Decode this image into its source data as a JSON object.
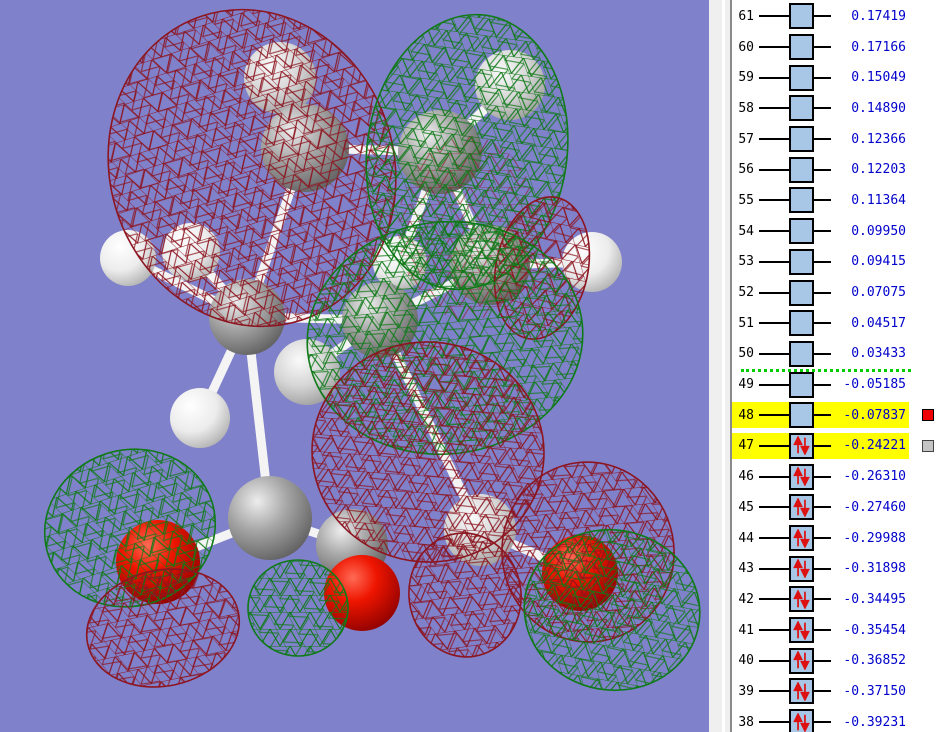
{
  "view": {
    "background_color": "#8081cb",
    "description": "3d-molecular-orbital-view"
  },
  "molecule": {
    "positive_mesh_color": "#8c1520",
    "negative_mesh_color": "#0f7a18",
    "oxygen_color": "#dd1100",
    "carbon_color": "#909090",
    "hydrogen_color": "#f2f2f2"
  },
  "diagram": {
    "box_fill": "#a8c6e6",
    "value_color": "#0000cc",
    "arrow_color": "#dd1111",
    "highlight_color": "#ffff00",
    "separator_color": "#00cc00",
    "marker_red": "#ee0000",
    "marker_gray": "#c4c4c4",
    "separator_between": [
      "50",
      "49"
    ],
    "rows": [
      {
        "n": "61",
        "value": "0.17419",
        "occupied": false,
        "highlighted": false,
        "marker": null
      },
      {
        "n": "60",
        "value": "0.17166",
        "occupied": false,
        "highlighted": false,
        "marker": null
      },
      {
        "n": "59",
        "value": "0.15049",
        "occupied": false,
        "highlighted": false,
        "marker": null
      },
      {
        "n": "58",
        "value": "0.14890",
        "occupied": false,
        "highlighted": false,
        "marker": null
      },
      {
        "n": "57",
        "value": "0.12366",
        "occupied": false,
        "highlighted": false,
        "marker": null
      },
      {
        "n": "56",
        "value": "0.12203",
        "occupied": false,
        "highlighted": false,
        "marker": null
      },
      {
        "n": "55",
        "value": "0.11364",
        "occupied": false,
        "highlighted": false,
        "marker": null
      },
      {
        "n": "54",
        "value": "0.09950",
        "occupied": false,
        "highlighted": false,
        "marker": null
      },
      {
        "n": "53",
        "value": "0.09415",
        "occupied": false,
        "highlighted": false,
        "marker": null
      },
      {
        "n": "52",
        "value": "0.07075",
        "occupied": false,
        "highlighted": false,
        "marker": null
      },
      {
        "n": "51",
        "value": "0.04517",
        "occupied": false,
        "highlighted": false,
        "marker": null
      },
      {
        "n": "50",
        "value": "0.03433",
        "occupied": false,
        "highlighted": false,
        "marker": null
      },
      {
        "n": "49",
        "value": "-0.05185",
        "occupied": false,
        "highlighted": false,
        "marker": null
      },
      {
        "n": "48",
        "value": "-0.07837",
        "occupied": false,
        "highlighted": true,
        "marker": "red"
      },
      {
        "n": "47",
        "value": "-0.24221",
        "occupied": true,
        "highlighted": true,
        "marker": "gray"
      },
      {
        "n": "46",
        "value": "-0.26310",
        "occupied": true,
        "highlighted": false,
        "marker": null
      },
      {
        "n": "45",
        "value": "-0.27460",
        "occupied": true,
        "highlighted": false,
        "marker": null
      },
      {
        "n": "44",
        "value": "-0.29988",
        "occupied": true,
        "highlighted": false,
        "marker": null
      },
      {
        "n": "43",
        "value": "-0.31898",
        "occupied": true,
        "highlighted": false,
        "marker": null
      },
      {
        "n": "42",
        "value": "-0.34495",
        "occupied": true,
        "highlighted": false,
        "marker": null
      },
      {
        "n": "41",
        "value": "-0.35454",
        "occupied": true,
        "highlighted": false,
        "marker": null
      },
      {
        "n": "40",
        "value": "-0.36852",
        "occupied": true,
        "highlighted": false,
        "marker": null
      },
      {
        "n": "39",
        "value": "-0.37150",
        "occupied": true,
        "highlighted": false,
        "marker": null
      },
      {
        "n": "38",
        "value": "-0.39231",
        "occupied": true,
        "highlighted": false,
        "marker": null
      }
    ]
  }
}
